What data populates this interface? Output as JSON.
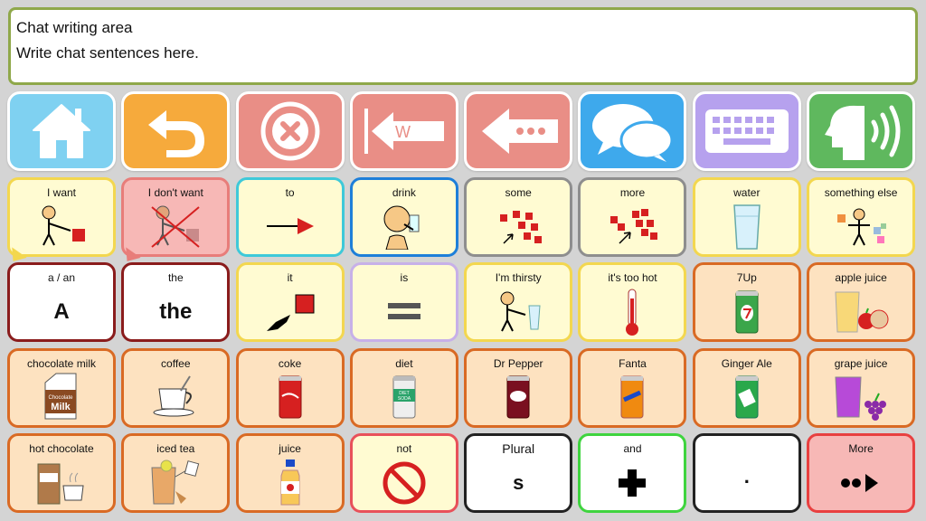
{
  "chat": {
    "title": "Chat writing area",
    "placeholder": "Write chat sentences here."
  },
  "tools": [
    {
      "name": "home",
      "icon": "home-icon"
    },
    {
      "name": "undo",
      "icon": "undo-arrow-icon"
    },
    {
      "name": "clear",
      "icon": "clear-x-icon"
    },
    {
      "name": "delete-word",
      "icon": "delete-word-icon",
      "letter": "W"
    },
    {
      "name": "backspace",
      "icon": "backspace-icon"
    },
    {
      "name": "chat",
      "icon": "chat-bubbles-icon"
    },
    {
      "name": "keyboard",
      "icon": "keyboard-icon"
    },
    {
      "name": "speak",
      "icon": "speak-icon"
    }
  ],
  "cells": {
    "i_want": "I want",
    "i_dont_want": "I don't want",
    "to": "to",
    "drink": "drink",
    "some": "some",
    "more": "more",
    "water": "water",
    "something_else": "something else",
    "a_an": "a / an",
    "a_an_sym": "A",
    "the": "the",
    "the_sym": "the",
    "it": "it",
    "is": "is",
    "im_thirsty": "I'm thirsty",
    "its_too_hot": "it's too hot",
    "sevenup": "7Up",
    "apple_juice": "apple juice",
    "chocolate_milk": "chocolate milk",
    "milk_carton_text": "Chocolate Milk",
    "coffee": "coffee",
    "coke": "coke",
    "diet": "diet",
    "diet_can_text": "DIET SODA",
    "dr_pepper": "Dr Pepper",
    "fanta": "Fanta",
    "ginger_ale": "Ginger Ale",
    "grape_juice": "grape juice",
    "hot_chocolate": "hot chocolate",
    "iced_tea": "iced tea",
    "juice": "juice",
    "not": "not",
    "plural": "Plural",
    "plural_sym": "s",
    "and": "and",
    "period_sym": ".",
    "more_nav": "More"
  }
}
